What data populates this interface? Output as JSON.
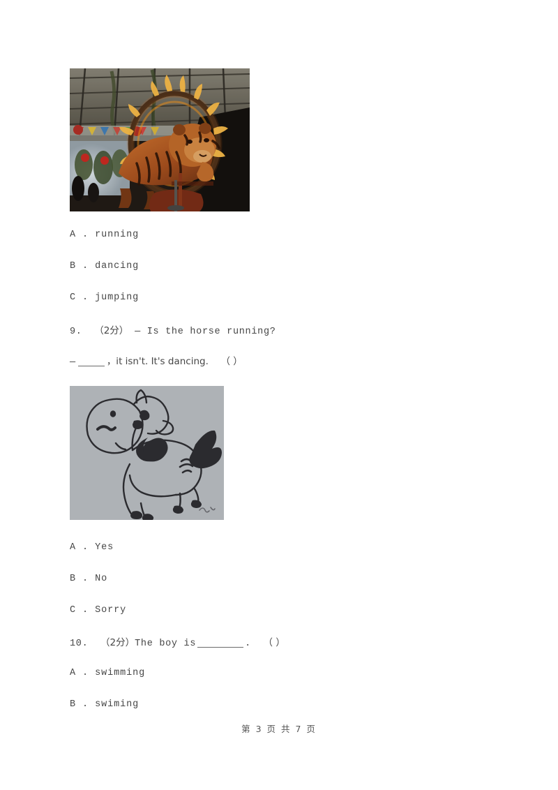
{
  "document": {
    "type": "exam-paper",
    "language": "zh-CN/en",
    "background_color": "#ffffff",
    "text_color": "#464646"
  },
  "figures": {
    "tiger": {
      "name": "tiger-jumping-through-fire-ring-photo",
      "alt": "A tiger leaping through a flaming hoop at a circus under a tent roof",
      "caption": "",
      "colors": {
        "background": "#201a16",
        "tiger_body": "#b55a22",
        "flame": "#ffb229",
        "tent_roof": "#6d6a60",
        "bright_area": "#c9d2d8"
      }
    },
    "horse": {
      "name": "horse-dancing-line-drawing",
      "alt": "Hand drawn ink sketch of a cartoon pony with a mane and tail",
      "caption": "",
      "colors": {
        "paper": "#a9adb2",
        "ink": "#2b2b2f"
      }
    }
  },
  "questions": [
    {
      "id": "q8-options",
      "options": [
        {
          "letter": "A",
          "separator": ".",
          "text": "running"
        },
        {
          "letter": "B",
          "separator": ".",
          "text": "dancing"
        },
        {
          "letter": "C",
          "separator": ".",
          "text": "jumping"
        }
      ]
    },
    {
      "id": "q9",
      "number": "9.",
      "score": "（2分）",
      "stem_line1": "— Is the horse running?",
      "stem_line2_before": "—",
      "stem_line2_after": "，it isn't. It's dancing.",
      "answer_bracket": "（    ）",
      "options": [
        {
          "letter": "A",
          "separator": ".",
          "text": "Yes"
        },
        {
          "letter": "B",
          "separator": ".",
          "text": "No"
        },
        {
          "letter": "C",
          "separator": ".",
          "text": "Sorry"
        }
      ]
    },
    {
      "id": "q10",
      "number": "10.",
      "score": "（2分）",
      "stem_before": "The boy is",
      "stem_after": ".",
      "answer_bracket": "（    ）",
      "options": [
        {
          "letter": "A",
          "separator": ".",
          "text": "swimming"
        },
        {
          "letter": "B",
          "separator": ".",
          "text": "swiming"
        }
      ]
    }
  ],
  "footer": {
    "text": "第 3 页 共 7 页",
    "page_number": "3",
    "total_pages": "7"
  }
}
